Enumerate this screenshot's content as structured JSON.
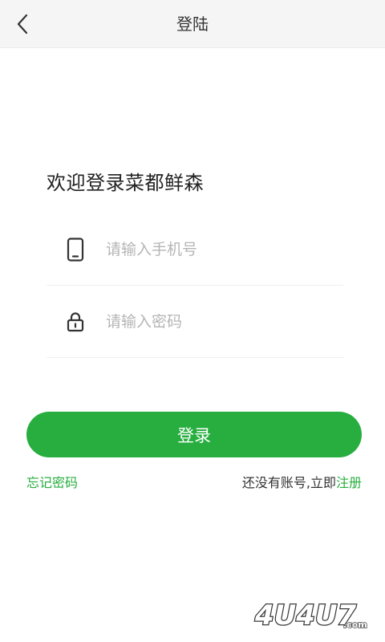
{
  "header": {
    "title": "登陆",
    "back_icon": "chevron-left-icon"
  },
  "welcome_text": "欢迎登录菜都鲜森",
  "phone_field": {
    "icon": "smartphone-icon",
    "placeholder": "请输入手机号",
    "value": ""
  },
  "password_field": {
    "icon": "lock-icon",
    "placeholder": "请输入密码",
    "value": ""
  },
  "login_button": {
    "label": "登录"
  },
  "links": {
    "forgot_password": "忘记密码",
    "no_account_prefix": "还没有账号,立即",
    "register": "注册"
  },
  "watermark": {
    "text": "4U4U7",
    "suffix": ".com"
  },
  "colors": {
    "accent": "#27ae3f",
    "header_bg": "#f5f5f5",
    "placeholder": "#b5b5b5"
  }
}
